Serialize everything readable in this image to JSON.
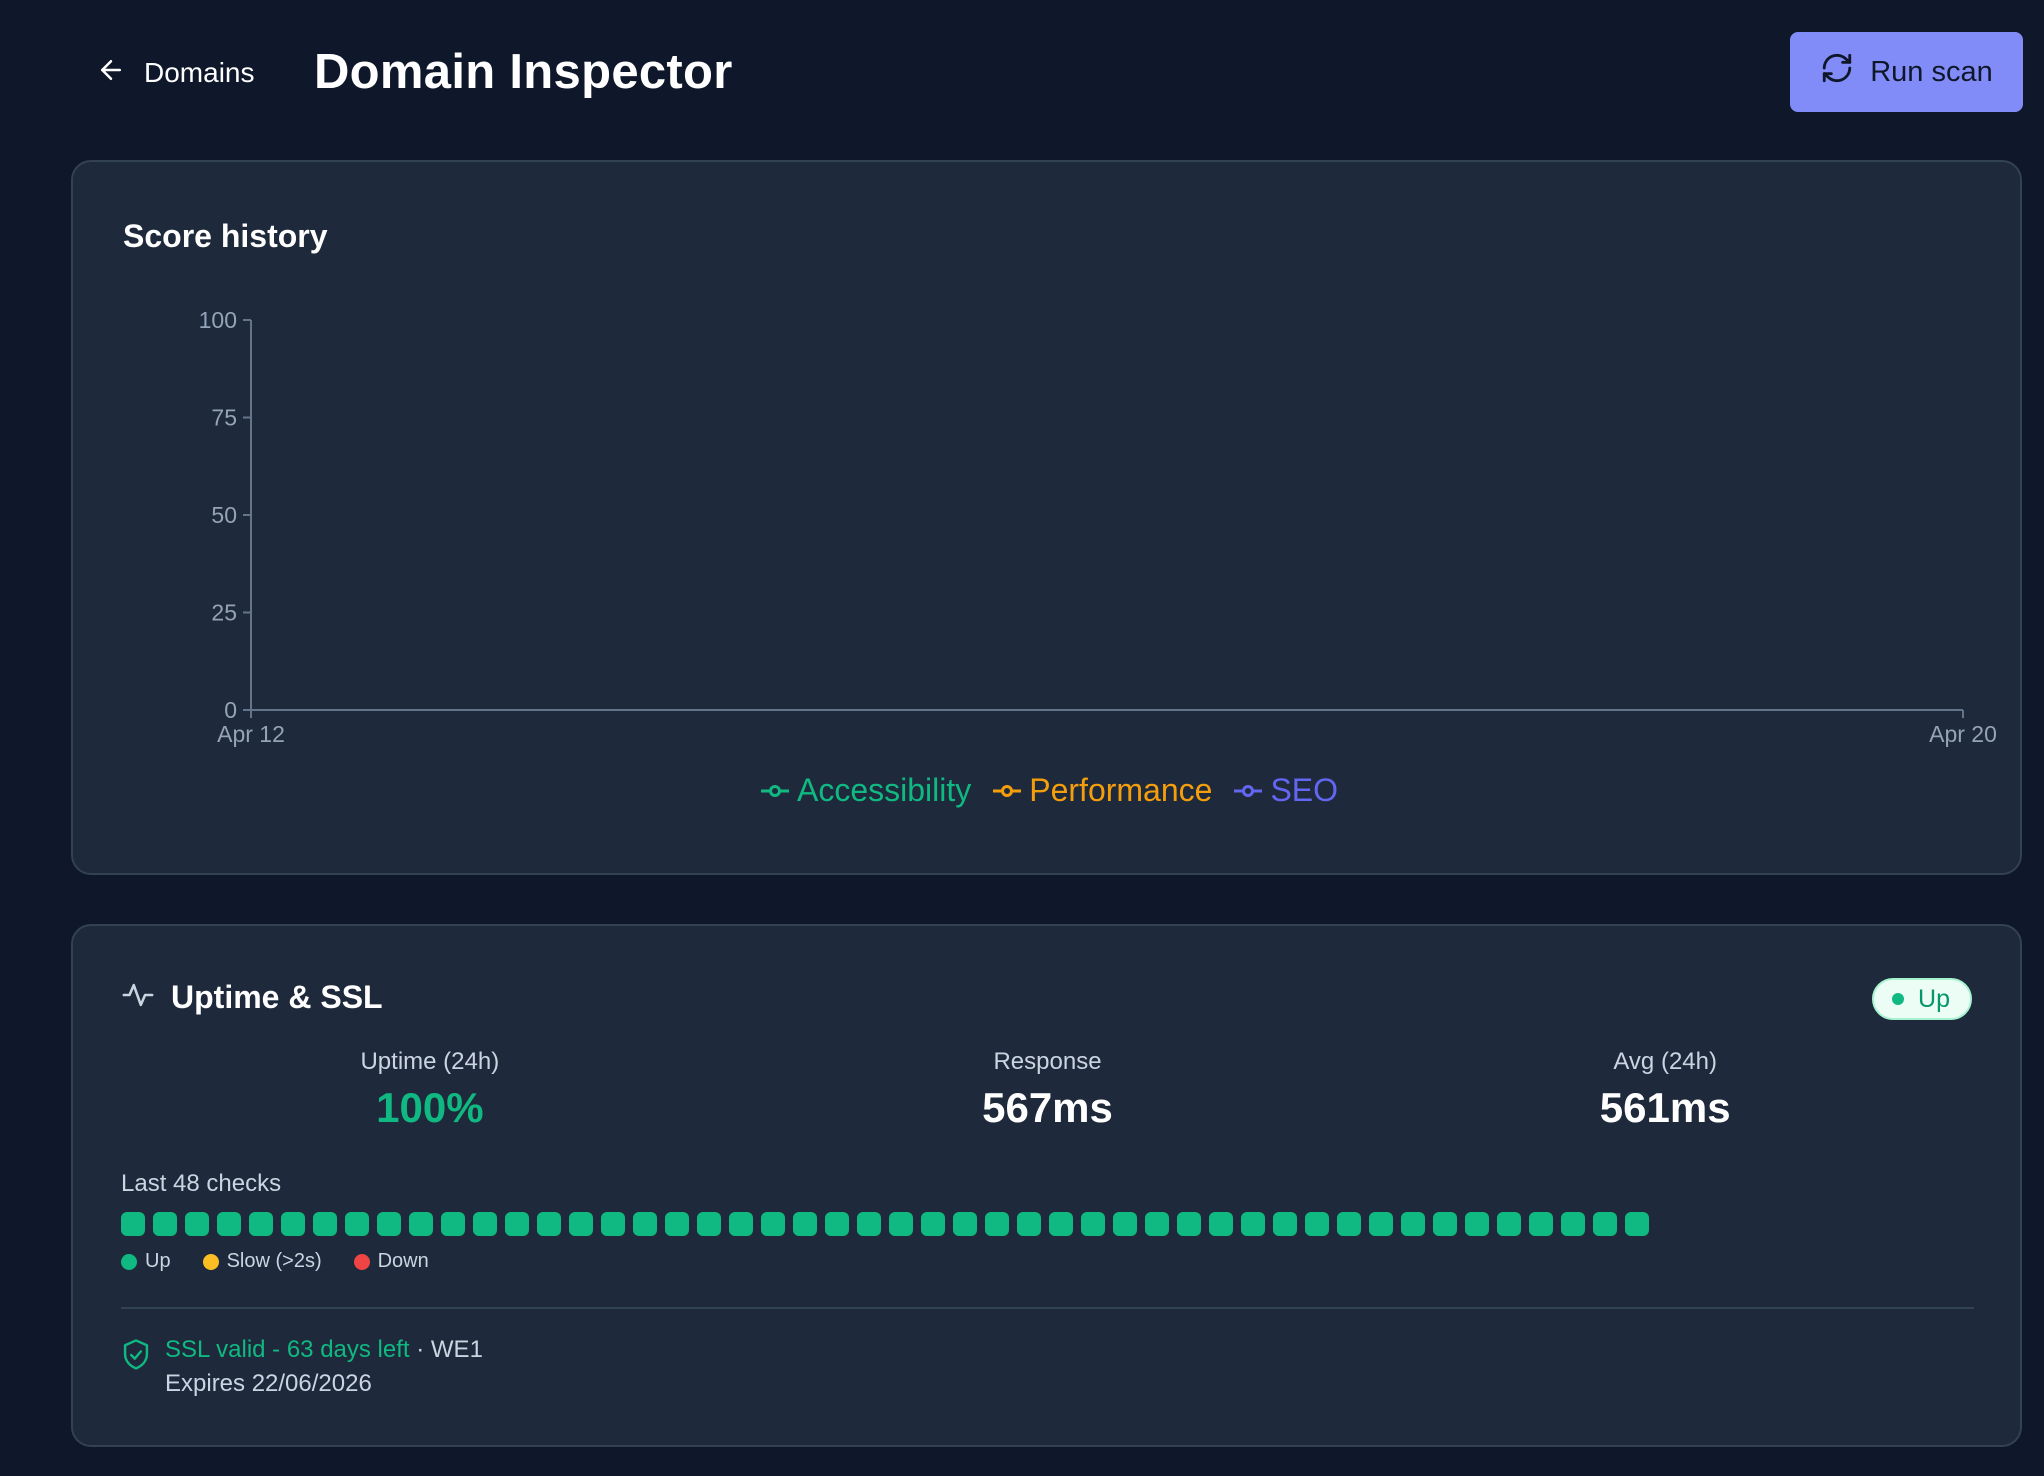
{
  "header": {
    "back_label": "Domains",
    "title": "Domain Inspector",
    "run_scan_label": "Run scan",
    "accent": "#818cf8"
  },
  "score_card": {
    "title": "Score history"
  },
  "chart_data": {
    "type": "line",
    "title": "Score history",
    "x_ticks": [
      "Apr 12",
      "Apr 20"
    ],
    "y_ticks": [
      0,
      25,
      50,
      75,
      100
    ],
    "ylim": [
      0,
      100
    ],
    "series": [
      {
        "name": "Accessibility",
        "color": "#10b981",
        "values": []
      },
      {
        "name": "Performance",
        "color": "#f59e0b",
        "values": []
      },
      {
        "name": "SEO",
        "color": "#6366f1",
        "values": []
      }
    ],
    "legend_position": "bottom-center",
    "grid": false
  },
  "uptime_card": {
    "title": "Uptime & SSL",
    "status": "Up",
    "stats": [
      {
        "label": "Uptime (24h)",
        "value": "100%"
      },
      {
        "label": "Response",
        "value": "567ms"
      },
      {
        "label": "Avg (24h)",
        "value": "561ms"
      }
    ],
    "checks_label": "Last 48 checks",
    "checks": [
      "up",
      "up",
      "up",
      "up",
      "up",
      "up",
      "up",
      "up",
      "up",
      "up",
      "up",
      "up",
      "up",
      "up",
      "up",
      "up",
      "up",
      "up",
      "up",
      "up",
      "up",
      "up",
      "up",
      "up",
      "up",
      "up",
      "up",
      "up",
      "up",
      "up",
      "up",
      "up",
      "up",
      "up",
      "up",
      "up",
      "up",
      "up",
      "up",
      "up",
      "up",
      "up",
      "up",
      "up",
      "up",
      "up",
      "up",
      "up"
    ],
    "check_colors": {
      "up": "#10b981",
      "slow": "#fbbf24",
      "down": "#ef4444"
    },
    "key": [
      {
        "label": "Up",
        "color": "#10b981"
      },
      {
        "label": "Slow (>2s)",
        "color": "#fbbf24"
      },
      {
        "label": "Down",
        "color": "#ef4444"
      }
    ],
    "ssl": {
      "status_text": "SSL valid - 63 days left",
      "issuer_text": " · WE1",
      "expires_text": "Expires 22/06/2026"
    }
  }
}
